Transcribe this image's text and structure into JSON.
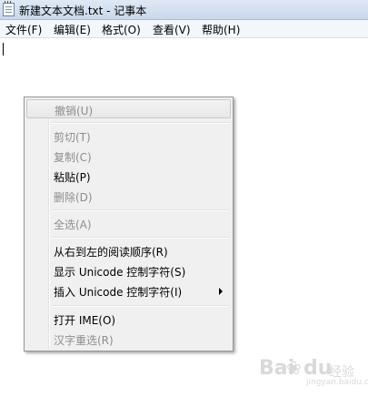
{
  "window": {
    "title": "新建文本文档.txt - 记事本",
    "icon": "notepad-icon"
  },
  "menubar": {
    "items": [
      {
        "label": "文件(F)"
      },
      {
        "label": "编辑(E)"
      },
      {
        "label": "格式(O)"
      },
      {
        "label": "查看(V)"
      },
      {
        "label": "帮助(H)"
      }
    ]
  },
  "context_menu": {
    "items": [
      {
        "label": "撤销(U)",
        "enabled": false
      },
      {
        "label": "剪切(T)",
        "enabled": false
      },
      {
        "label": "复制(C)",
        "enabled": false
      },
      {
        "label": "粘贴(P)",
        "enabled": true
      },
      {
        "label": "删除(D)",
        "enabled": false
      },
      {
        "label": "全选(A)",
        "enabled": false
      },
      {
        "label": "从右到左的阅读顺序(R)",
        "enabled": true
      },
      {
        "label": "显示 Unicode 控制字符(S)",
        "enabled": true
      },
      {
        "label": "插入 Unicode 控制字符(I)",
        "enabled": true,
        "submenu": true
      },
      {
        "label": "打开 IME(O)",
        "enabled": true
      },
      {
        "label": "汉字重选(R)",
        "enabled": false
      }
    ]
  },
  "watermark": {
    "brand": "Bai",
    "brand_suffix": "du",
    "product": "经验",
    "url": "jingyan.baidu.com"
  }
}
